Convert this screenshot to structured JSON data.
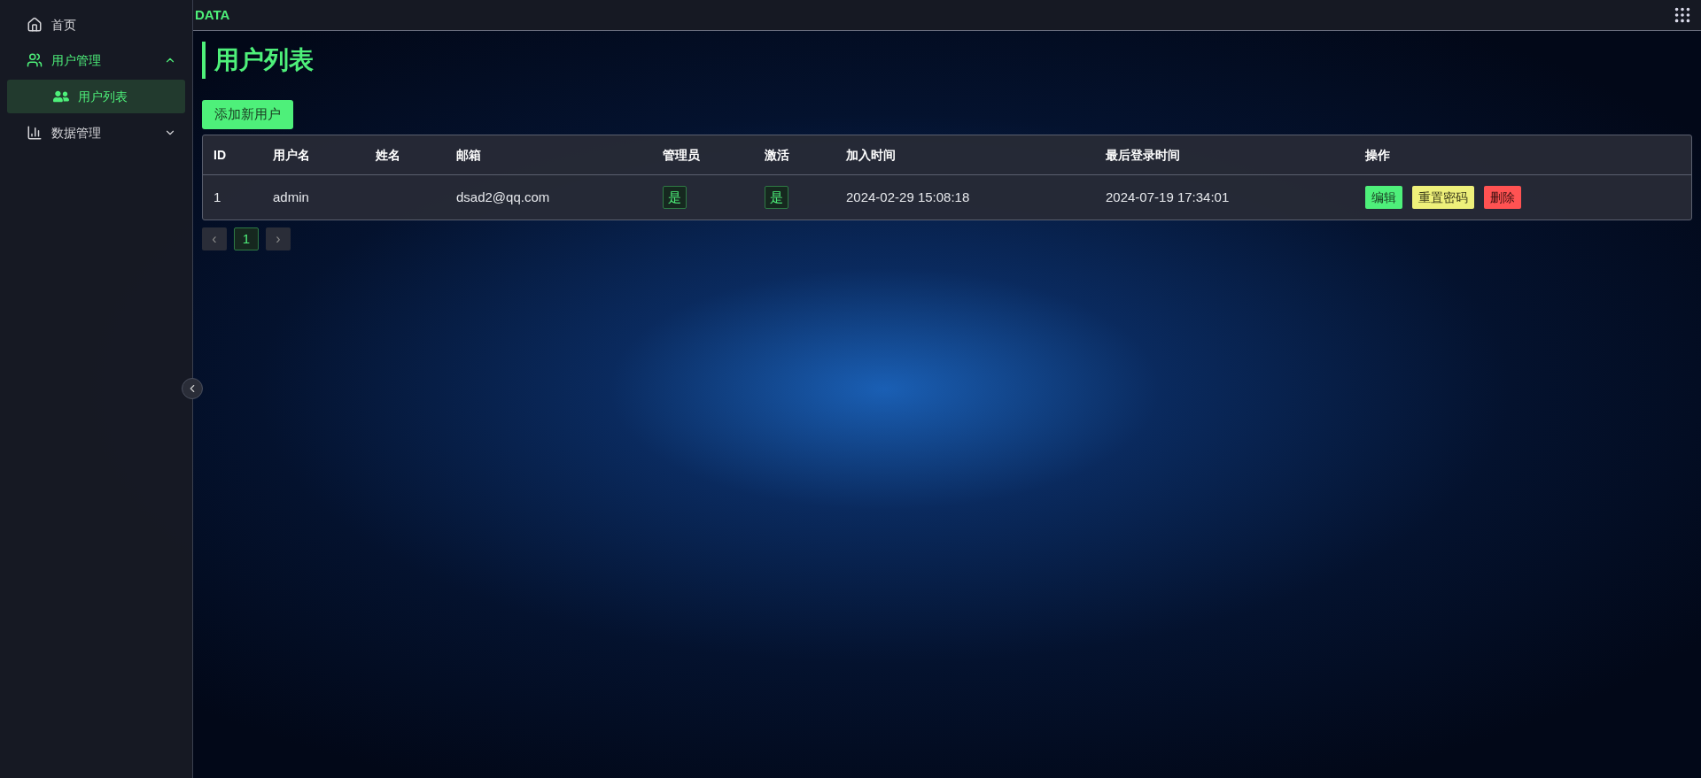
{
  "sidebar": {
    "items": [
      {
        "label": "首页",
        "kind": "home",
        "selected": false
      },
      {
        "label": "用户管理",
        "kind": "users",
        "selected": true,
        "expanded": true,
        "children": [
          {
            "label": "用户列表",
            "kind": "users-solid",
            "selected": true
          }
        ]
      },
      {
        "label": "数据管理",
        "kind": "chart",
        "selected": false,
        "expanded": false
      }
    ]
  },
  "header": {
    "brand": "DATA"
  },
  "page": {
    "title": "用户列表",
    "add_button": "添加新用户",
    "table": {
      "columns": [
        "ID",
        "用户名",
        "姓名",
        "邮箱",
        "管理员",
        "激活",
        "加入时间",
        "最后登录时间",
        "操作"
      ],
      "rows": [
        {
          "id": "1",
          "username": "admin",
          "email": "dsad2@qq.com",
          "admin": "是",
          "active": "是",
          "joined": "2024-02-29 15:08:18",
          "last_login": "2024-07-19 17:34:01",
          "actions": [
            {
              "label": "编辑",
              "kind": "edit"
            },
            {
              "label": "重置密码",
              "kind": "reset"
            },
            {
              "label": "删除",
              "kind": "delete"
            }
          ]
        }
      ]
    },
    "pagination": {
      "prev": "‹",
      "next": "›",
      "pages": [
        {
          "label": "1",
          "selected": true
        }
      ]
    }
  }
}
